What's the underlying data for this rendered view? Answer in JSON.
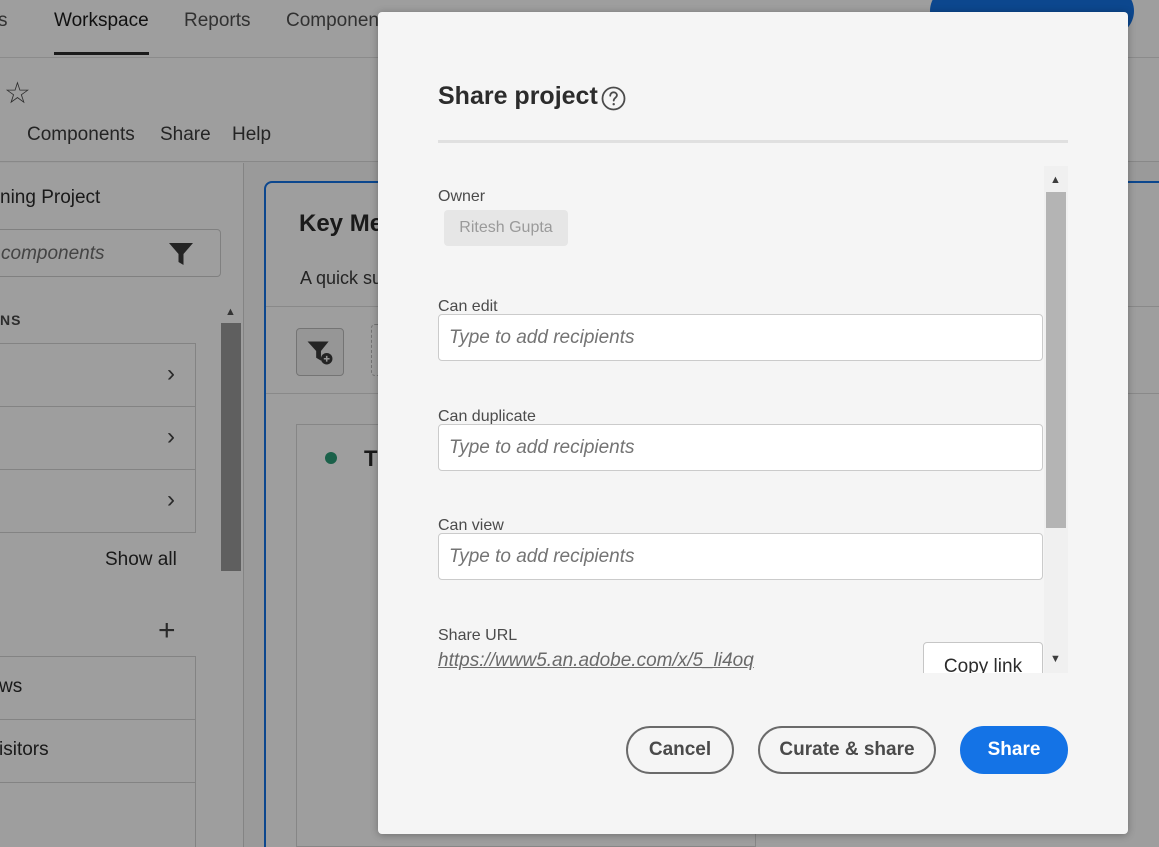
{
  "background": {
    "topnav": {
      "tabs": [
        "s",
        "Workspace",
        "Reports",
        "Componen"
      ],
      "active_tab": "Workspace"
    },
    "menu": [
      "t",
      "Components",
      "Share",
      "Help"
    ],
    "left_panel": {
      "project_title": "ning Project",
      "search_placeholder": "components",
      "section_label": "NS",
      "rows_top": [
        "",
        "",
        ""
      ],
      "show_all": "Show all",
      "rows_bottom": [
        "ws",
        "isitors",
        ""
      ]
    },
    "canvas": {
      "title": "Key Me",
      "subtitle": "A quick su",
      "panel_text": "T"
    }
  },
  "dialog": {
    "title": "Share project",
    "owner": {
      "label": "Owner",
      "name": "Ritesh Gupta"
    },
    "can_edit": {
      "label": "Can edit",
      "placeholder": "Type to add recipients"
    },
    "can_duplicate": {
      "label": "Can duplicate",
      "placeholder": "Type to add recipients"
    },
    "can_view": {
      "label": "Can view",
      "placeholder": "Type to add recipients"
    },
    "share_url": {
      "label": "Share URL",
      "value": "https://www5.an.adobe.com/x/5_li4oq",
      "copy_label": "Copy link"
    },
    "buttons": {
      "cancel": "Cancel",
      "curate": "Curate & share",
      "share": "Share"
    }
  },
  "colors": {
    "accent": "#1473e6",
    "status_dot": "#2d9d78"
  }
}
